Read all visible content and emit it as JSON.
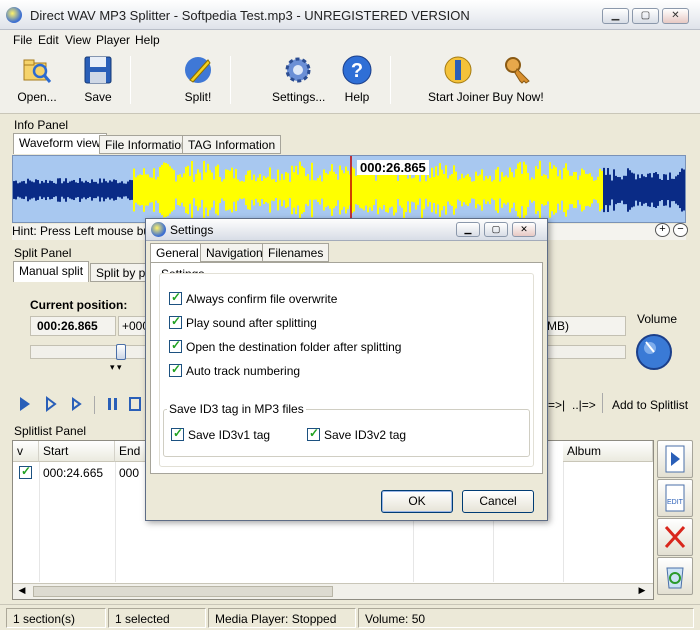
{
  "window": {
    "title": "Direct WAV MP3 Splitter - Softpedia Test.mp3 - UNREGISTERED VERSION",
    "minimize": "▁",
    "maximize": "▢",
    "close": "✕"
  },
  "menu": [
    "File",
    "Edit",
    "View",
    "Player",
    "Help"
  ],
  "toolbar": {
    "open": "Open...",
    "save": "Save",
    "split": "Split!",
    "settings": "Settings...",
    "help": "Help",
    "start_joiner": "Start Joiner",
    "buy_now": "Buy Now!"
  },
  "info_panel": {
    "label": "Info Panel",
    "tabs": [
      "Waveform view",
      "File Information",
      "TAG Information"
    ],
    "time_marker": "000:26.865",
    "hint": "Hint: Press Left mouse butt"
  },
  "split_panel": {
    "label": "Split Panel",
    "tabs": [
      "Manual split",
      "Split by pa"
    ],
    "current_position_label": "Current position:",
    "current_position": "000:26.865",
    "offset_value": "+000",
    "size_fragment": "MB)",
    "volume_label": "Volume",
    "split_nav_left": "=>|",
    "split_nav_right": "..|=>",
    "add_to_splitlist": "Add to Splitlist"
  },
  "splitlist_panel": {
    "label": "Splitlist Panel",
    "columns": [
      "v",
      "Start",
      "End",
      "Album"
    ],
    "rows": [
      {
        "checked": true,
        "start": "000:24.665",
        "end": "000"
      }
    ]
  },
  "statusbar": {
    "sections": "1 section(s)",
    "selected": "1 selected",
    "player": "Media Player: Stopped",
    "volume": "Volume: 50"
  },
  "dialog": {
    "title": "Settings",
    "tabs": [
      "General",
      "Navigation",
      "Filenames"
    ],
    "settings_group_label": "Settings",
    "options": [
      {
        "label": "Always confirm file overwrite",
        "checked": true
      },
      {
        "label": "Play sound after splitting",
        "checked": true
      },
      {
        "label": "Open the destination folder after splitting",
        "checked": true
      },
      {
        "label": "Auto track numbering",
        "checked": true
      }
    ],
    "id3_group_label": "Save ID3 tag in MP3 files",
    "id3v1": {
      "label": "Save ID3v1 tag",
      "checked": true
    },
    "id3v2": {
      "label": "Save ID3v2 tag",
      "checked": true
    },
    "ok": "OK",
    "cancel": "Cancel"
  },
  "colors": {
    "waveform_background": "#a8c8f0",
    "waveform_wave": "#0a2b86",
    "waveform_selection": "#ffff00",
    "position_line": "#c00000"
  }
}
